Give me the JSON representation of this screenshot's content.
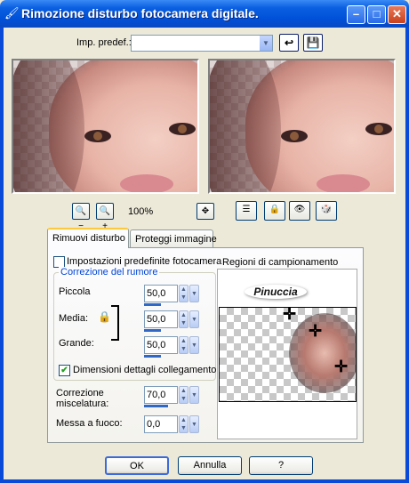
{
  "window": {
    "title": "Rimozione disturbo fotocamera digitale."
  },
  "preset": {
    "label": "Imp. predef.:",
    "value": ""
  },
  "zoom": {
    "value": "100%"
  },
  "tabs": [
    {
      "label": "Rimuovi disturbo"
    },
    {
      "label": "Proteggi immagine"
    }
  ],
  "defaults_checkbox": {
    "label": "Impostazioni predefinite fotocamera",
    "checked": false
  },
  "noise_group": {
    "label": "Correzione del rumore",
    "small": {
      "label": "Piccola",
      "value": "50,0",
      "level": 0.5
    },
    "medium": {
      "label": "Media:",
      "value": "50,0",
      "level": 0.5
    },
    "large": {
      "label": "Grande:",
      "value": "50,0",
      "level": 0.5
    },
    "link": {
      "label": "Dimensioni dettagli collegamento",
      "checked": true
    }
  },
  "blend": {
    "label_line1": "Correzione",
    "label_line2": "miscelatura:",
    "value": "70,0",
    "level": 0.7
  },
  "sharpen": {
    "label": "Messa a fuoco:",
    "value": "0,0"
  },
  "sampling": {
    "label": "Regioni di campionamento",
    "logo": "Pinuccia"
  },
  "buttons": {
    "ok": "OK",
    "cancel": "Annulla",
    "help": "?"
  }
}
